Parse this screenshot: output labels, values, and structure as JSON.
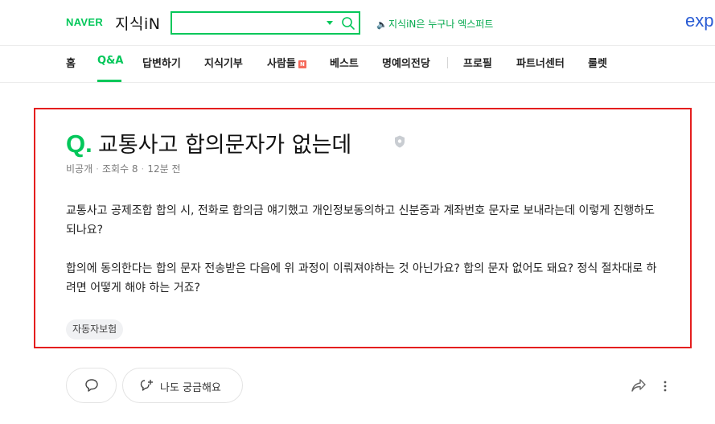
{
  "header": {
    "naver_logo": "NAVER",
    "kin_logo": "지식iN",
    "search": {
      "value": "",
      "placeholder": ""
    },
    "notice": "지식iN은 누구나 엑스퍼트",
    "expert_logo": "exp"
  },
  "nav": {
    "items": [
      {
        "label": "홈"
      },
      {
        "label": "Q&A"
      },
      {
        "label": "답변하기"
      },
      {
        "label": "지식기부"
      },
      {
        "label": "사람들"
      },
      {
        "label": "베스트"
      },
      {
        "label": "명예의전당"
      },
      {
        "label": "프로필"
      },
      {
        "label": "파트너센터"
      },
      {
        "label": "룰렛"
      }
    ],
    "active": "Q&A",
    "new_badge": "N"
  },
  "question": {
    "q_mark": "Q.",
    "title": "교통사고 합의문자가 없는데",
    "meta": {
      "author": "비공개",
      "views": "조회수 8",
      "time": "12분 전"
    },
    "paragraphs": [
      "교통사고 공제조합 합의 시, 전화로 합의금 얘기했고 개인정보동의하고 신분증과 계좌번호 문자로 보내라는데 이렇게 진행하도 되나요?",
      "합의에 동의한다는 합의 문자 전송받은 다음에 위 과정이 이뤄져야하는 것 아닌가요? 합의 문자 없어도 돼요? 정식 절차대로 하려면 어떻게 해야 하는 거죠?"
    ],
    "tag": "자동자보험"
  },
  "actions": {
    "curious_label": "나도 궁금해요"
  },
  "colors": {
    "brand": "#03c75a",
    "highlight_border": "#e41e1e"
  }
}
